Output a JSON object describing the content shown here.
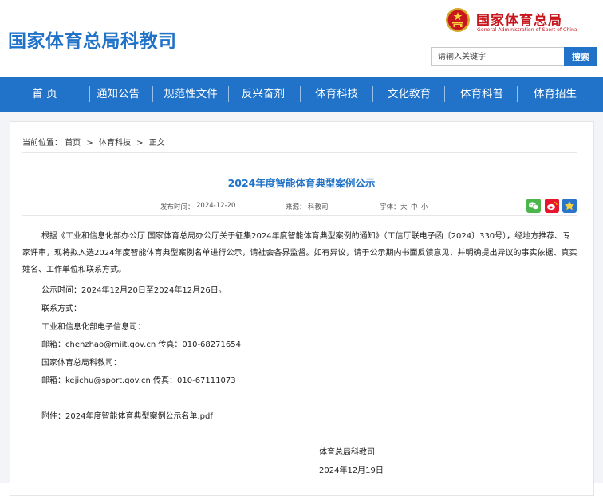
{
  "header": {
    "site_title": "国家体育总局科教司",
    "org_name_cn": "国家体育总局",
    "org_name_en": "General Administration of Sport of China",
    "search": {
      "placeholder": "请输入关键字",
      "button_label": "搜索"
    }
  },
  "nav": {
    "items": [
      {
        "label": "首 页"
      },
      {
        "label": "通知公告"
      },
      {
        "label": "规范性文件"
      },
      {
        "label": "反兴奋剂"
      },
      {
        "label": "体育科技"
      },
      {
        "label": "文化教育"
      },
      {
        "label": "体育科普"
      },
      {
        "label": "体育招生"
      }
    ]
  },
  "breadcrumb": {
    "prefix": "当前位置：",
    "items": [
      "首页",
      "体育科技",
      "正文"
    ],
    "separator": ">"
  },
  "article": {
    "title": "2024年度智能体育典型案例公示",
    "meta": {
      "date_label": "发布时间：",
      "date": "2024-12-20",
      "source_label": "来源：",
      "source": "科教司",
      "font_label": "字体：",
      "font_large": "大",
      "font_medium": "中",
      "font_small": "小"
    },
    "share_icons": [
      "wechat-icon",
      "weibo-icon",
      "favorite-icon"
    ],
    "paragraph1": "根据《工业和信息化部办公厅 国家体育总局办公厅关于征集2024年度智能体育典型案例的通知》（工信厅联电子函〔2024〕330号），经地方推荐、专家评审，现将拟入选2024年度智能体育典型案例名单进行公示，请社会各界监督。如有异议，请于公示期内书面反馈意见，并明确提出异议的事实依据、真实姓名、工作单位和联系方式。",
    "period": "公示时间：2024年12月20日至2024年12月26日。",
    "contact_label": "联系方式：",
    "contact1_org": "工业和信息化部电子信息司：",
    "contact1_detail": "邮箱：chenzhao@miit.gov.cn  传真：010-68271654",
    "contact2_org": "国家体育总局科教司：",
    "contact2_detail": "邮箱：kejichu@sport.gov.cn  传真：010-67111073",
    "attachment": "附件：2024年度智能体育典型案例公示名单.pdf",
    "signature": "体育总局科教司",
    "signature_date": "2024年12月19日"
  },
  "colors": {
    "brand_blue": "#2173c9",
    "brand_red": "#c8161d"
  }
}
